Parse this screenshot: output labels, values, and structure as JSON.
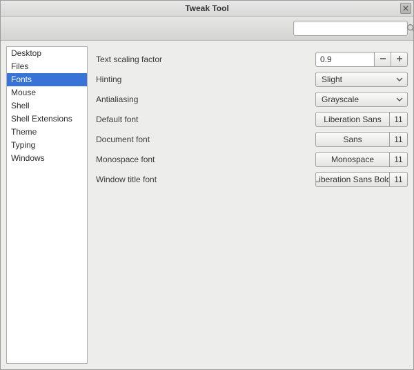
{
  "window": {
    "title": "Tweak Tool"
  },
  "search": {
    "value": "",
    "placeholder": ""
  },
  "sidebar": {
    "items": [
      {
        "label": "Desktop",
        "selected": false
      },
      {
        "label": "Files",
        "selected": false
      },
      {
        "label": "Fonts",
        "selected": true
      },
      {
        "label": "Mouse",
        "selected": false
      },
      {
        "label": "Shell",
        "selected": false
      },
      {
        "label": "Shell Extensions",
        "selected": false
      },
      {
        "label": "Theme",
        "selected": false
      },
      {
        "label": "Typing",
        "selected": false
      },
      {
        "label": "Windows",
        "selected": false
      }
    ]
  },
  "settings": {
    "text_scaling": {
      "label": "Text scaling factor",
      "value": "0.9"
    },
    "hinting": {
      "label": "Hinting",
      "value": "Slight"
    },
    "antialiasing": {
      "label": "Antialiasing",
      "value": "Grayscale"
    },
    "default_font": {
      "label": "Default font",
      "family": "Liberation Sans",
      "size": "11"
    },
    "document_font": {
      "label": "Document font",
      "family": "Sans",
      "size": "11"
    },
    "monospace_font": {
      "label": "Monospace font",
      "family": "Monospace",
      "size": "11"
    },
    "window_title_font": {
      "label": "Window title font",
      "family": "Liberation Sans Bold",
      "size": "11"
    }
  }
}
